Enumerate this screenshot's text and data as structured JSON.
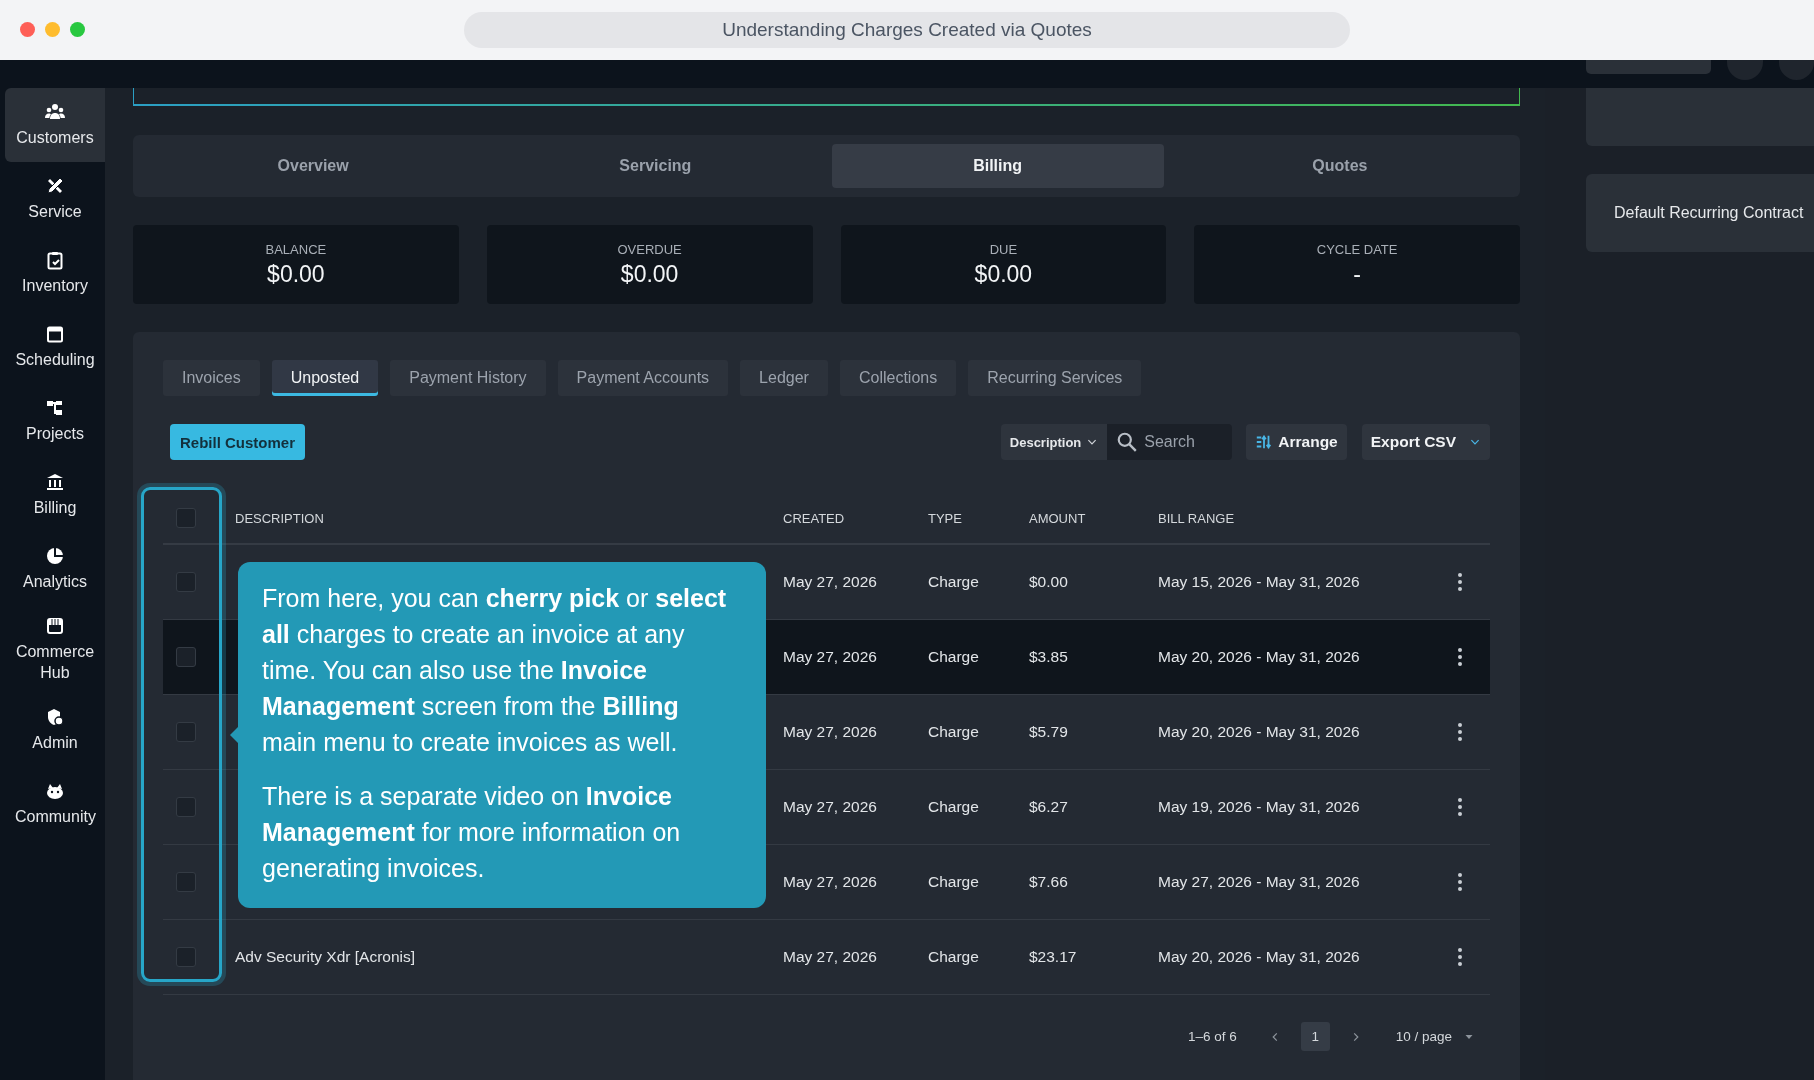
{
  "window": {
    "title": "Understanding Charges Created via Quotes"
  },
  "sidebar": {
    "items": [
      {
        "label": "Customers",
        "selected": true
      },
      {
        "label": "Service",
        "selected": false
      },
      {
        "label": "Inventory",
        "selected": false
      },
      {
        "label": "Scheduling",
        "selected": false
      },
      {
        "label": "Projects",
        "selected": false
      },
      {
        "label": "Billing",
        "selected": false
      },
      {
        "label": "Analytics",
        "selected": false
      },
      {
        "label": "Commerce Hub",
        "selected": false
      },
      {
        "label": "Admin",
        "selected": false
      },
      {
        "label": "Community",
        "selected": false
      }
    ]
  },
  "tabs": [
    {
      "label": "Overview",
      "selected": false
    },
    {
      "label": "Servicing",
      "selected": false
    },
    {
      "label": "Billing",
      "selected": true
    },
    {
      "label": "Quotes",
      "selected": false
    }
  ],
  "summary": [
    {
      "label": "BALANCE",
      "value": "$0.00"
    },
    {
      "label": "OVERDUE",
      "value": "$0.00"
    },
    {
      "label": "DUE",
      "value": "$0.00"
    },
    {
      "label": "CYCLE DATE",
      "value": "-"
    }
  ],
  "subtabs": [
    {
      "label": "Invoices",
      "selected": false
    },
    {
      "label": "Unposted",
      "selected": true
    },
    {
      "label": "Payment History",
      "selected": false
    },
    {
      "label": "Payment Accounts",
      "selected": false
    },
    {
      "label": "Ledger",
      "selected": false
    },
    {
      "label": "Collections",
      "selected": false
    },
    {
      "label": "Recurring Services",
      "selected": false
    }
  ],
  "toolbar": {
    "rebill_button": "Rebill Customer",
    "filter_field": "Description",
    "search": {
      "placeholder": "Search"
    },
    "arrange_button": "Arrange",
    "export_button": "Export CSV"
  },
  "table": {
    "select_all": {
      "checked": false
    },
    "columns": [
      "DESCRIPTION",
      "CREATED",
      "TYPE",
      "AMOUNT",
      "BILL RANGE"
    ],
    "rows": [
      {
        "checked": false,
        "highlighted": false,
        "created": "May 27, 2026",
        "type": "Charge",
        "amount": "$0.00",
        "bill_range": "May 15, 2026 - May 31, 2026"
      },
      {
        "checked": false,
        "highlighted": true,
        "created": "May 27, 2026",
        "type": "Charge",
        "amount": "$3.85",
        "bill_range": "May 20, 2026 - May 31, 2026"
      },
      {
        "checked": false,
        "highlighted": false,
        "created": "May 27, 2026",
        "type": "Charge",
        "amount": "$5.79",
        "bill_range": "May 20, 2026 - May 31, 2026"
      },
      {
        "checked": false,
        "highlighted": false,
        "created": "May 27, 2026",
        "type": "Charge",
        "amount": "$6.27",
        "bill_range": "May 19, 2026 - May 31, 2026"
      },
      {
        "checked": false,
        "highlighted": false,
        "created": "May 27, 2026",
        "type": "Charge",
        "amount": "$7.66",
        "bill_range": "May 27, 2026 - May 31, 2026"
      },
      {
        "checked": false,
        "highlighted": false,
        "description": "Adv Security Xdr [Acronis]",
        "created": "May 27, 2026",
        "type": "Charge",
        "amount": "$23.17",
        "bill_range": "May 20, 2026 - May 31, 2026"
      }
    ]
  },
  "pagination": {
    "summary": "1–6 of 6",
    "pages": [
      {
        "label": "1",
        "selected": true
      }
    ],
    "page_size": "10 / page"
  },
  "tooltip": {
    "paragraphs": [
      "From here, you can **cherry pick** or **select all** charges to create an invoice at any time. You can also use the **Invoice Management** screen from the **Billing** main menu to create invoices as well.",
      "There is a separate video on **Invoice Management** for more information on generating invoices."
    ]
  },
  "right_panel": {
    "contract": "Default Recurring Contract"
  }
}
